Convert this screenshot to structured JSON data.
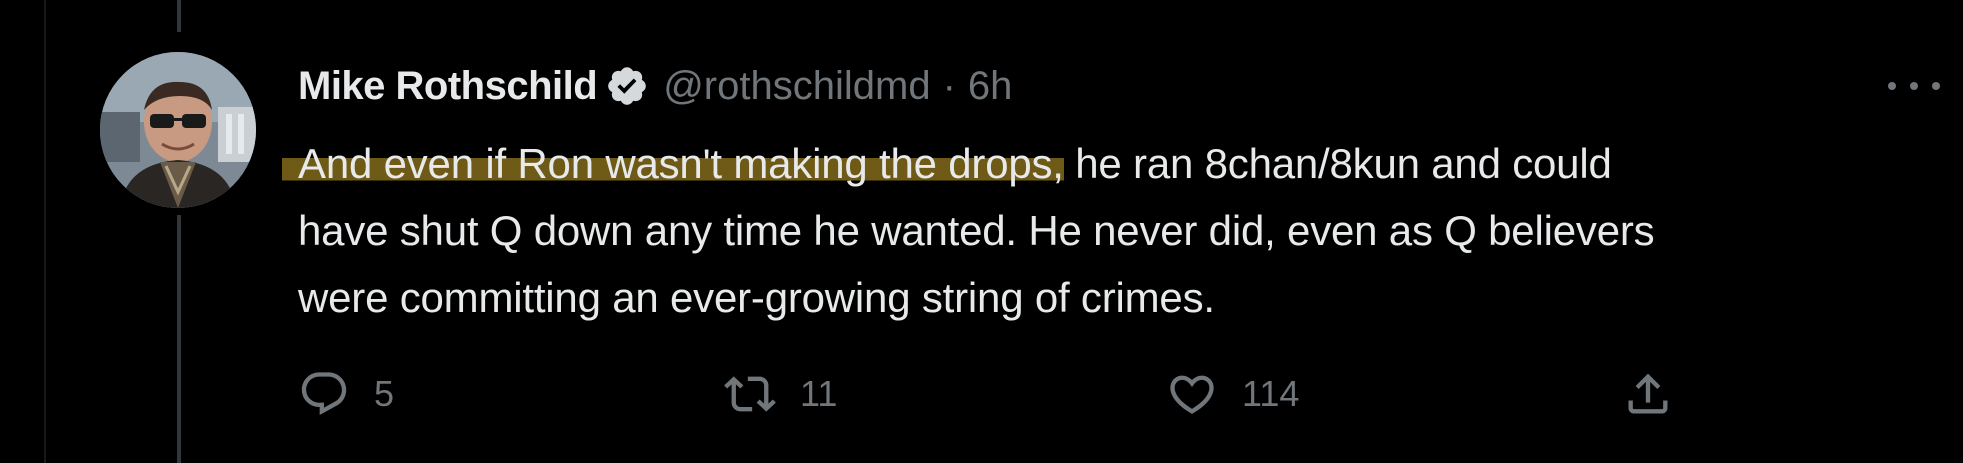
{
  "tweet": {
    "display_name": "Mike Rothschild",
    "handle": "@rothschildmd",
    "separator": "·",
    "time": "6h",
    "verified": true,
    "text_highlighted": "And even if Ron wasn't making the drops,",
    "text_line1_rest": " he ran 8chan/8kun and could",
    "text_line2": "have shut Q down any time he wanted. He never did, even as Q believers",
    "text_line3": "were committing an ever-growing string of crimes.",
    "highlight_color": "#c8a528"
  },
  "actions": {
    "reply_count": "5",
    "retweet_count": "11",
    "like_count": "114"
  },
  "icons": {
    "verified": "verified-badge-icon",
    "more": "more-icon",
    "reply": "reply-icon",
    "retweet": "retweet-icon",
    "like": "heart-icon",
    "share": "share-icon"
  },
  "colors": {
    "background": "#000000",
    "text": "#e7e9ea",
    "secondary": "#71767b",
    "thread_line": "#333639"
  }
}
